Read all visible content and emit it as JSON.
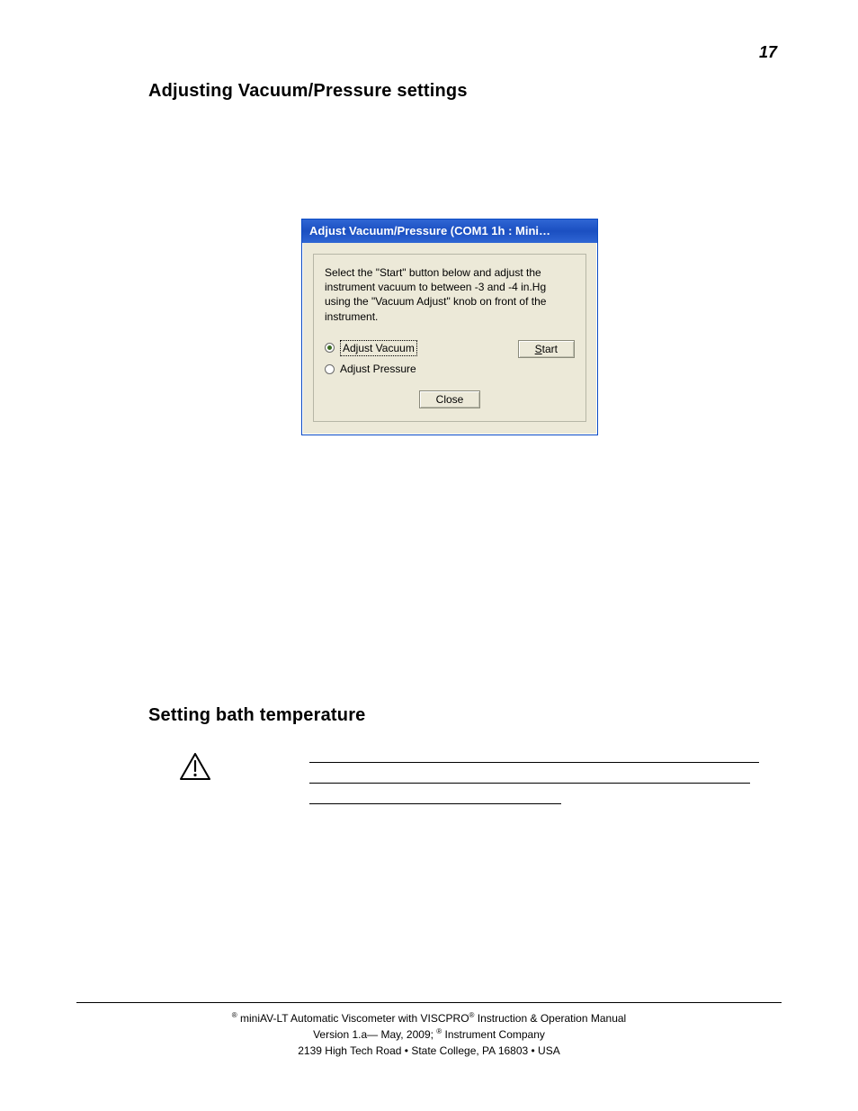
{
  "page_number": "17",
  "headings": {
    "adjusting": "Adjusting Vacuum/Pressure settings",
    "setting_bath": "Setting bath temperature"
  },
  "dialog": {
    "title": "Adjust Vacuum/Pressure (COM1 1h : Mini…",
    "instruction": "Select the \"Start\" button below and adjust the instrument vacuum to between -3 and -4 in.Hg using the \"Vacuum Adjust\" knob on front of the instrument.",
    "radio_vacuum": "Adjust Vacuum",
    "radio_pressure": "Adjust Pressure",
    "start_prefix": "S",
    "start_rest": "tart",
    "close": "Close"
  },
  "footer": {
    "line1_pre": " miniAV-LT Automatic Viscometer with VISCPRO",
    "line1_post": " Instruction & Operation Manual",
    "line2_a": "Version 1.a— May, 2009; ",
    "line2_b": " Instrument Company",
    "line3": "2139 High Tech Road • State College, PA  16803 • USA",
    "reg": "®"
  }
}
